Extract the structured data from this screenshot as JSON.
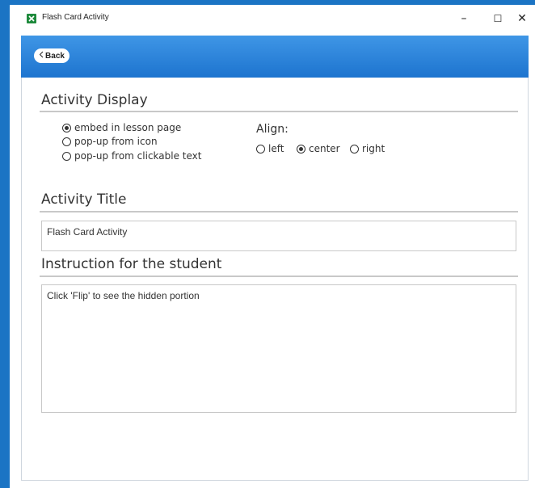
{
  "window": {
    "title": "Flash Card Activity",
    "controls": {
      "minimize": "–",
      "maximize": "☐",
      "close": "✕"
    }
  },
  "header": {
    "back_label": "Back",
    "back_icon": "chevron-left-icon"
  },
  "activity_display": {
    "heading": "Activity Display",
    "options": [
      {
        "label": "embed in lesson page",
        "checked": true
      },
      {
        "label": "pop-up from icon",
        "checked": false
      },
      {
        "label": "pop-up from clickable text",
        "checked": false
      }
    ],
    "align": {
      "label": "Align:",
      "options": [
        {
          "label": "left",
          "checked": false
        },
        {
          "label": "center",
          "checked": true
        },
        {
          "label": "right",
          "checked": false
        }
      ]
    }
  },
  "activity_title": {
    "heading": "Activity Title",
    "value": "Flash Card Activity"
  },
  "instruction": {
    "heading": "Instruction for the student",
    "value": "Click 'Flip' to see the hidden portion"
  },
  "colors": {
    "accent": "#1d74cf",
    "header_top": "#3f96e6",
    "app_icon": "#1e8a3c"
  }
}
